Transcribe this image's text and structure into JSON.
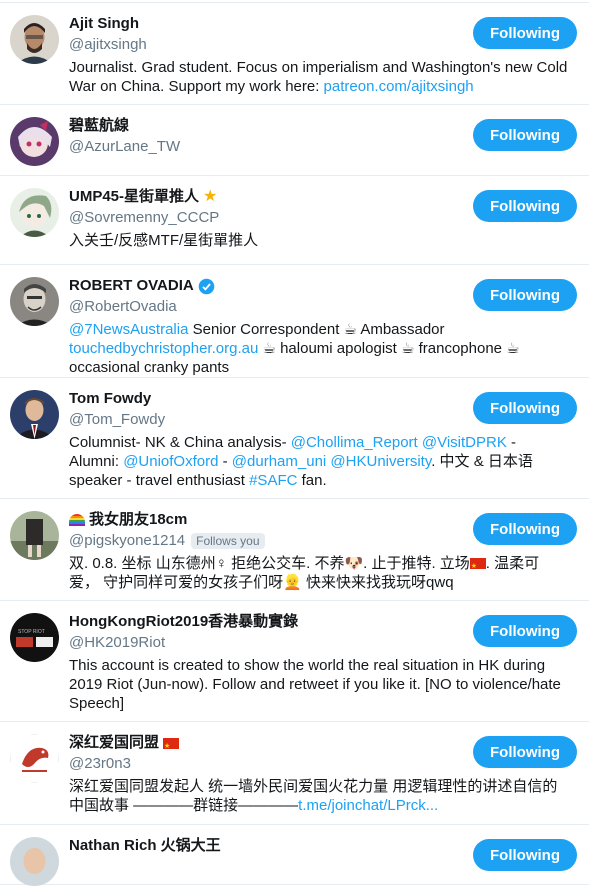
{
  "follow_button_label": "Following",
  "users": [
    {
      "name": "Ajit Singh",
      "handle": "@ajitxsingh",
      "bio": [
        {
          "t": "Journalist. Grad student. Focus on imperialism and Washington's new Cold War on China. Support my work here: "
        },
        {
          "t": "patreon.com/ajitxsingh",
          "link": true
        }
      ]
    },
    {
      "name": "碧藍航線",
      "handle": "@AzurLane_TW",
      "bio": []
    },
    {
      "name": "UMP45-星街單推人",
      "handle": "@Sovremenny_CCCP",
      "bio": [
        {
          "t": "入关壬/反感MTF/星街單推人"
        }
      ]
    },
    {
      "name": "ROBERT OVADIA",
      "handle": "@RobertOvadia",
      "bio": [
        {
          "t": "@7NewsAustralia",
          "link": true
        },
        {
          "t": " Senior Correspondent ☕ Ambassador "
        },
        {
          "t": "touchedbychristopher.org.au",
          "link": true
        },
        {
          "t": " ☕ haloumi apologist ☕ francophone ☕ occasional cranky pants"
        }
      ]
    },
    {
      "name": "Tom Fowdy",
      "handle": "@Tom_Fowdy",
      "bio": [
        {
          "t": "Columnist- NK & China analysis- "
        },
        {
          "t": "@Chollima_Report",
          "link": true
        },
        {
          "t": " "
        },
        {
          "t": "@VisitDPRK",
          "link": true
        },
        {
          "t": " - Alumni: "
        },
        {
          "t": "@UniofOxford",
          "link": true
        },
        {
          "t": " - "
        },
        {
          "t": "@durham_uni",
          "link": true
        },
        {
          "t": " "
        },
        {
          "t": "@HKUniversity",
          "link": true
        },
        {
          "t": ". 中文 & 日本语 speaker - travel enthusiast "
        },
        {
          "t": "#SAFC",
          "link": true
        },
        {
          "t": " fan."
        }
      ]
    },
    {
      "name": "我女朋友18cm",
      "handle": "@pigskyone1214",
      "follows_you": "Follows you",
      "bio": [
        {
          "t": "双. 0.8. 坐标 山东德州♀ 拒绝公交车. 不养🐶. 止于推特. 立场"
        },
        {
          "t": "FLAG"
        },
        {
          "t": ". 温柔可爱， 守护同样可爱的女孩子们呀👱 快来快来找我玩呀qwq"
        }
      ]
    },
    {
      "name": "HongKongRiot2019香港暴動實錄",
      "handle": "@HK2019Riot",
      "bio": [
        {
          "t": "This account is created to show the world the real situation in HK during 2019 Riot (Jun-now). Follow and retweet if you like it. [NO to violence/hate Speech]"
        }
      ]
    },
    {
      "name": "深红爱国同盟",
      "handle": "@23r0n3",
      "bio": [
        {
          "t": "深红爱国同盟发起人 统一墙外民间爱国火花力量 用逻辑理性的讲述自信的中国故事 ————群链接————"
        },
        {
          "t": "t.me/joinchat/LPrck...",
          "link": true
        }
      ]
    },
    {
      "name": "Nathan Rich 火锅大王",
      "handle": "",
      "bio": []
    }
  ],
  "colors": {
    "accent": "#1da1f2",
    "muted": "#657786",
    "divider": "#e6ecf0"
  }
}
